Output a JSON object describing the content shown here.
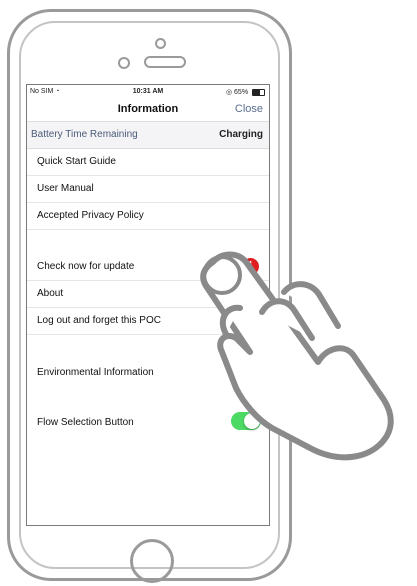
{
  "status_bar": {
    "carrier": "No SIM",
    "time": "10:31 AM",
    "battery": "65%"
  },
  "nav": {
    "title": "Information",
    "close_label": "Close"
  },
  "battery_row": {
    "label": "Battery Time Remaining",
    "value": "Charging"
  },
  "section1": [
    {
      "label": "Quick Start Guide"
    },
    {
      "label": "User Manual"
    },
    {
      "label": "Accepted Privacy Policy"
    }
  ],
  "section2": [
    {
      "label": "Check now for update",
      "badge": "i"
    },
    {
      "label": "About"
    },
    {
      "label": "Log out and forget this POC"
    }
  ],
  "toggles": [
    {
      "label": "Environmental Information",
      "on": false
    },
    {
      "label": "Flow Selection Button",
      "on": true
    }
  ],
  "colors": {
    "accent_toggle": "#4cd964",
    "alert_badge": "#e02020",
    "link": "#5a6e8c"
  }
}
